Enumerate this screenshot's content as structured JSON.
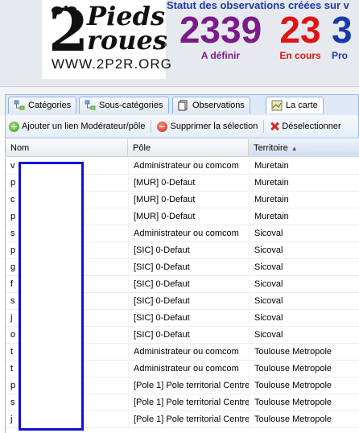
{
  "header": {
    "logo": {
      "digit": "2",
      "word1": "Pieds",
      "word2": "roues",
      "url": "WWW.2P2R.ORG"
    },
    "stats_title": "Statut des observations créées sur v",
    "stats": [
      {
        "value": "2339",
        "label": "A définir",
        "color": "#7b1a8a"
      },
      {
        "value": "23",
        "label": "En cours",
        "color": "#e01414"
      },
      {
        "value": "3",
        "label": "Pro",
        "color": "#1a3aa6"
      }
    ]
  },
  "tabs": [
    {
      "label": "Catégories",
      "icon": "hierarchy-icon"
    },
    {
      "label": "Sous-catégories",
      "icon": "hierarchy-icon"
    },
    {
      "label": "Observations",
      "icon": "document-icon"
    },
    {
      "label": "La carte",
      "icon": "map-icon"
    }
  ],
  "toolbar": {
    "add_label": "Ajouter un lien Modérateur/pôle",
    "delete_label": "Supprimer la sélection",
    "deselect_label": "Déselectionner"
  },
  "grid": {
    "columns": [
      "Nom",
      "Pôle",
      "Territoire"
    ],
    "sort_column": "Territoire",
    "sort_direction": "asc",
    "rows": [
      {
        "nom": "v",
        "pole": "Administrateur ou comcom",
        "territoire": "Muretain"
      },
      {
        "nom": "p",
        "pole": "[MUR] 0-Defaut",
        "territoire": "Muretain"
      },
      {
        "nom": "c",
        "pole": "[MUR] 0-Defaut",
        "territoire": "Muretain"
      },
      {
        "nom": "p",
        "pole": "[MUR] 0-Defaut",
        "territoire": "Muretain"
      },
      {
        "nom": "s",
        "pole": "Administrateur ou comcom",
        "territoire": "Sicoval"
      },
      {
        "nom": "p",
        "pole": "[SIC] 0-Defaut",
        "territoire": "Sicoval"
      },
      {
        "nom": "g",
        "pole": "[SIC] 0-Defaut",
        "territoire": "Sicoval"
      },
      {
        "nom": "f",
        "pole": "[SIC] 0-Defaut",
        "territoire": "Sicoval"
      },
      {
        "nom": "s",
        "pole": "[SIC] 0-Defaut",
        "territoire": "Sicoval"
      },
      {
        "nom": "j",
        "pole": "[SIC] 0-Defaut",
        "territoire": "Sicoval"
      },
      {
        "nom": "o",
        "pole": "[SIC] 0-Defaut",
        "territoire": "Sicoval"
      },
      {
        "nom": "t",
        "pole": "Administrateur ou comcom",
        "territoire": "Toulouse Metropole"
      },
      {
        "nom": "t",
        "pole": "Administrateur ou comcom",
        "territoire": "Toulouse Metropole"
      },
      {
        "nom": "p",
        "pole": "[Pole 1] Pole territorial Centre",
        "territoire": "Toulouse Metropole"
      },
      {
        "nom": "s",
        "pole": "[Pole 1] Pole territorial Centre",
        "territoire": "Toulouse Metropole"
      },
      {
        "nom": "j",
        "pole": "[Pole 1] Pole territorial Centre",
        "territoire": "Toulouse Metropole"
      }
    ]
  },
  "colors": {
    "accent_border": "#99bbe8",
    "redaction_border": "#1010d8"
  }
}
